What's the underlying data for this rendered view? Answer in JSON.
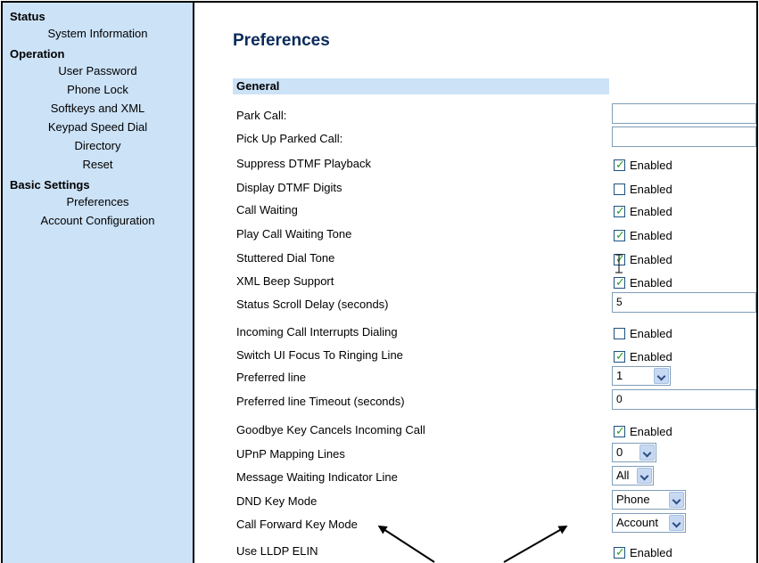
{
  "sidebar": {
    "sections": [
      {
        "label": "Status",
        "items": [
          {
            "label": "System Information"
          }
        ]
      },
      {
        "label": "Operation",
        "items": [
          {
            "label": "User Password"
          },
          {
            "label": "Phone Lock"
          },
          {
            "label": "Softkeys and XML"
          },
          {
            "label": "Keypad Speed Dial"
          },
          {
            "label": "Directory"
          },
          {
            "label": "Reset"
          }
        ]
      },
      {
        "label": "Basic Settings",
        "items": [
          {
            "label": "Preferences"
          },
          {
            "label": "Account Configuration"
          }
        ]
      }
    ]
  },
  "main": {
    "title": "Preferences",
    "section": "General",
    "checkbox_label": "Enabled",
    "rows": [
      {
        "label": "Park Call:",
        "control": "text",
        "value": ""
      },
      {
        "label": "Pick Up Parked Call:",
        "control": "text",
        "value": ""
      },
      {
        "label": "Suppress DTMF Playback",
        "control": "checkbox",
        "checked": true
      },
      {
        "label": "Display DTMF Digits",
        "control": "checkbox",
        "checked": false
      },
      {
        "label": "Call Waiting",
        "control": "checkbox",
        "checked": true
      },
      {
        "label": "Play Call Waiting Tone",
        "control": "checkbox",
        "checked": true
      },
      {
        "label": "Stuttered Dial Tone",
        "control": "checkbox",
        "checked": true
      },
      {
        "label": "XML Beep Support",
        "control": "checkbox",
        "checked": true
      },
      {
        "label": "Status Scroll Delay (seconds)",
        "control": "text",
        "value": "5"
      },
      {
        "label": "Incoming Call Interrupts Dialing",
        "control": "checkbox",
        "checked": false
      },
      {
        "label": "Switch UI Focus To Ringing Line",
        "control": "checkbox",
        "checked": true
      },
      {
        "label": "Preferred line",
        "control": "select",
        "value": "1"
      },
      {
        "label": "Preferred line Timeout (seconds)",
        "control": "text",
        "value": "0"
      },
      {
        "label": "Goodbye Key Cancels Incoming Call",
        "control": "checkbox",
        "checked": true
      },
      {
        "label": "UPnP Mapping Lines",
        "control": "select",
        "value": "0"
      },
      {
        "label": "Message Waiting Indicator Line",
        "control": "select",
        "value": "All"
      },
      {
        "label": "DND Key Mode",
        "control": "select",
        "value": "Phone"
      },
      {
        "label": "Call Forward Key Mode",
        "control": "select",
        "value": "Account"
      },
      {
        "label": "Use LLDP ELIN",
        "control": "checkbox",
        "checked": true
      }
    ]
  },
  "colors": {
    "sidebar_bg": "#cce2f7",
    "title": "#0a2a5c",
    "check": "#21a121"
  },
  "icons": {
    "checkbox_tick": "check-icon",
    "dropdown": "chevron-down-icon",
    "annotation": "arrow-icon"
  }
}
